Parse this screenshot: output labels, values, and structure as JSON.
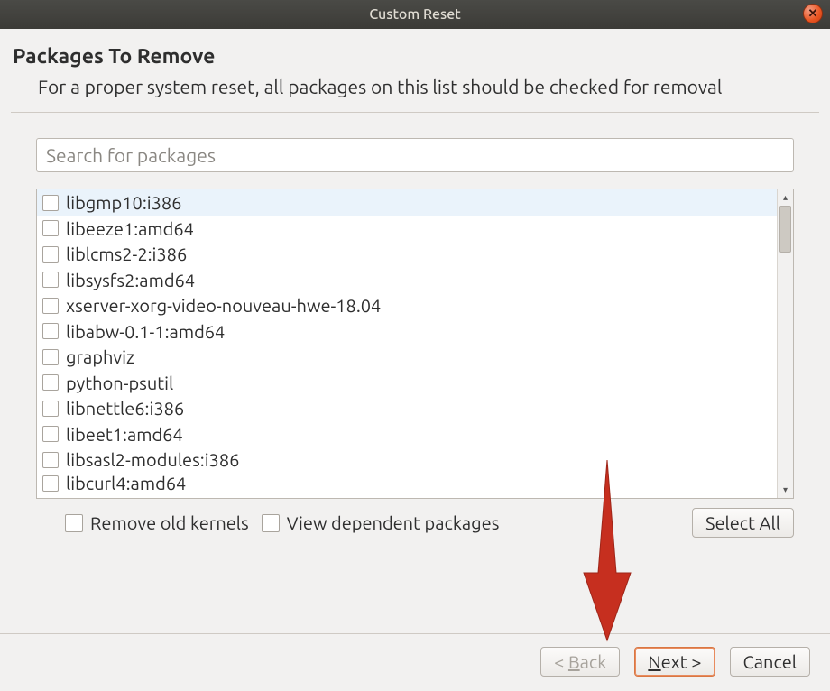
{
  "window": {
    "title": "Custom Reset"
  },
  "header": {
    "title": "Packages To Remove",
    "subtitle": "For a proper system reset, all packages on this list should be checked for removal"
  },
  "search": {
    "placeholder": "Search for packages",
    "value": ""
  },
  "packages": [
    {
      "name": "libgmp10:i386",
      "checked": false,
      "selected": true
    },
    {
      "name": "libeeze1:amd64",
      "checked": false,
      "selected": false
    },
    {
      "name": "liblcms2-2:i386",
      "checked": false,
      "selected": false
    },
    {
      "name": "libsysfs2:amd64",
      "checked": false,
      "selected": false
    },
    {
      "name": "xserver-xorg-video-nouveau-hwe-18.04",
      "checked": false,
      "selected": false
    },
    {
      "name": "libabw-0.1-1:amd64",
      "checked": false,
      "selected": false
    },
    {
      "name": "graphviz",
      "checked": false,
      "selected": false
    },
    {
      "name": "python-psutil",
      "checked": false,
      "selected": false
    },
    {
      "name": "libnettle6:i386",
      "checked": false,
      "selected": false
    },
    {
      "name": "libeet1:amd64",
      "checked": false,
      "selected": false
    },
    {
      "name": "libsasl2-modules:i386",
      "checked": false,
      "selected": false
    },
    {
      "name": "libcurl4:amd64",
      "checked": false,
      "selected": false
    }
  ],
  "options": {
    "remove_old_kernels": {
      "label": "Remove old kernels",
      "checked": false
    },
    "view_dependent": {
      "label": "View dependent packages",
      "checked": false
    },
    "select_all": "Select All"
  },
  "footer": {
    "back": "Back",
    "back_prefix": "< ",
    "next": "Next",
    "next_suffix": " >",
    "cancel": "Cancel"
  },
  "annotation": {
    "arrow_color": "#c0392b"
  }
}
